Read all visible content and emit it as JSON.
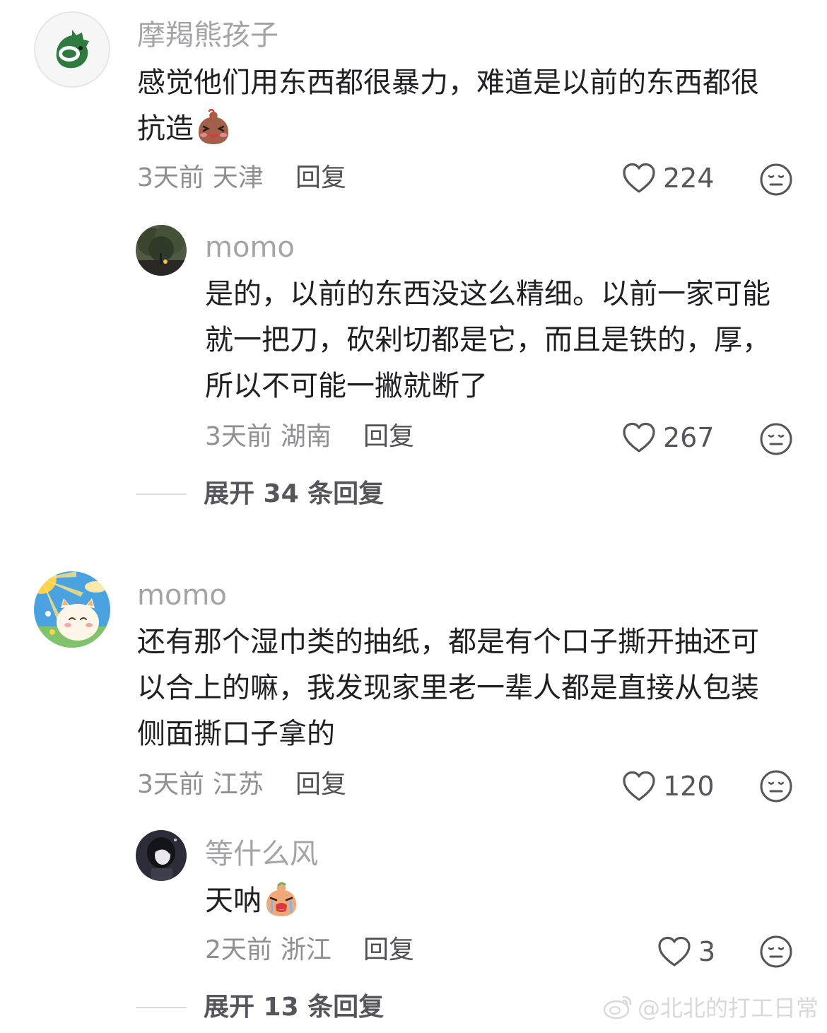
{
  "comments": [
    {
      "user": "摩羯熊孩子",
      "lines": [
        "感觉他们用东西都很暴力，难道是以前的东西都很",
        "抗造"
      ],
      "emoji": "shy-mole-emoji",
      "time": "3天前",
      "location": "天津",
      "reply_label": "回复",
      "likes": "224",
      "replies": [
        {
          "user": "momo",
          "lines": [
            "是的，以前的东西没这么精细。以前一家可能",
            "就一把刀，砍剁切都是它，而且是铁的，厚，",
            "所以不可能一撇就断了"
          ],
          "time": "3天前",
          "location": "湖南",
          "reply_label": "回复",
          "likes": "267"
        }
      ],
      "expand_label": "展开 34 条回复"
    },
    {
      "user": "momo",
      "lines": [
        "还有那个湿巾类的抽纸，都是有个口子撕开抽还可",
        "以合上的嘛，我发现家里老一辈人都是直接从包装",
        "侧面撕口子拿的"
      ],
      "time": "3天前",
      "location": "江苏",
      "reply_label": "回复",
      "likes": "120",
      "replies": [
        {
          "user": "等什么风",
          "lines": [
            "天呐"
          ],
          "emoji": "crying-mole-emoji",
          "time": "2天前",
          "location": "浙江",
          "reply_label": "回复",
          "likes": "3"
        }
      ],
      "expand_label": "展开 13 条回复"
    }
  ],
  "icons": {
    "like": "heart-outline-icon",
    "dislike": "meh-face-icon",
    "watermark": "weibo-logo-icon"
  },
  "watermark": "@北北的打工日常",
  "colors": {
    "username": "#a3a3a8",
    "text": "#1f1f24",
    "meta": "#8e8e93",
    "watermark": "#d9d9dd"
  }
}
